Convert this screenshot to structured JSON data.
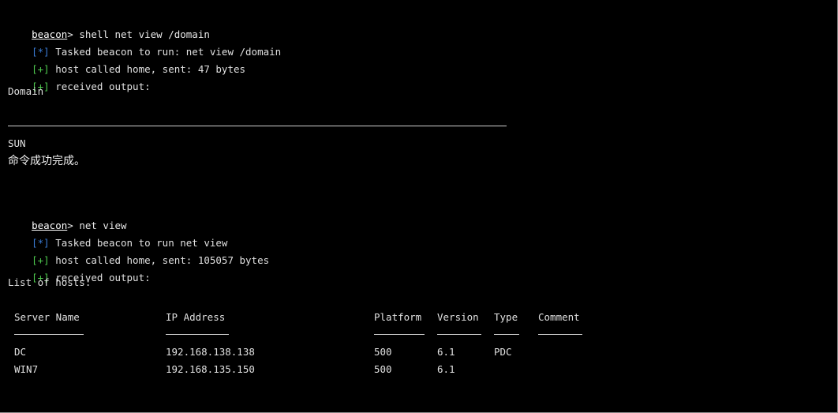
{
  "session1": {
    "prompt": "beacon",
    "separator": ">",
    "command": " shell net view /domain",
    "tasked_tag": "[*]",
    "tasked_text": " Tasked beacon to run: net view /domain",
    "sent_tag": "[+]",
    "sent_text": " host called home, sent: 47 bytes",
    "received_tag": "[+]",
    "received_text": " received output:",
    "output_header": "Domain",
    "domain_value": "SUN",
    "success_message": "命令成功完成。"
  },
  "session2": {
    "prompt": "beacon",
    "separator": ">",
    "command": " net view",
    "tasked_tag": "[*]",
    "tasked_text": " Tasked beacon to run net view",
    "sent_tag": "[+]",
    "sent_text": " host called home, sent: 105057 bytes",
    "received_tag": "[+]",
    "received_text": " received output:",
    "list_title": "List of hosts:"
  },
  "hosts_table": {
    "columns": [
      "Server Name",
      "IP Address",
      "Platform",
      "Version",
      "Type",
      "Comment"
    ],
    "rows": [
      [
        "DC",
        "192.168.138.138",
        "500",
        "6.1",
        "PDC",
        ""
      ],
      [
        "WIN7",
        "192.168.135.150",
        "500",
        "6.1",
        "",
        ""
      ]
    ]
  },
  "colors": {
    "background": "#000000",
    "info_tag": "#3a7bd5",
    "ok_tag": "#4ec94e",
    "text": "#e0e0e0"
  }
}
